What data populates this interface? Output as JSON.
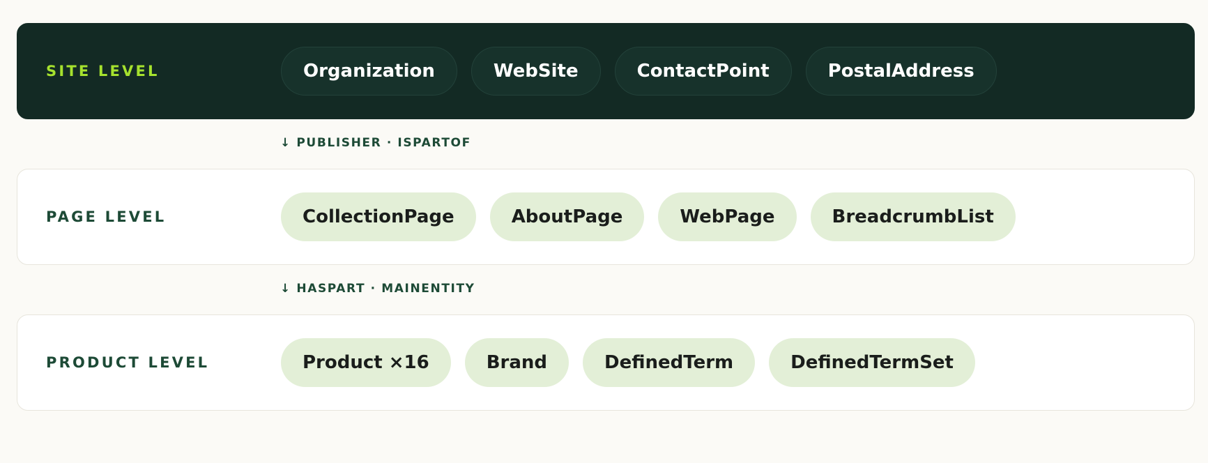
{
  "levels": [
    {
      "label": "SITE LEVEL",
      "theme": "dark",
      "chips": [
        "Organization",
        "WebSite",
        "ContactPoint",
        "PostalAddress"
      ]
    },
    {
      "label": "PAGE LEVEL",
      "theme": "light",
      "chips": [
        "CollectionPage",
        "AboutPage",
        "WebPage",
        "BreadcrumbList"
      ]
    },
    {
      "label": "PRODUCT LEVEL",
      "theme": "light",
      "chips": [
        "Product ×16",
        "Brand",
        "DefinedTerm",
        "DefinedTermSet"
      ]
    }
  ],
  "connectors": [
    "↓ PUBLISHER · ISPARTOF",
    "↓ HASPART · MAINENTITY"
  ],
  "colors": {
    "background": "#fbfaf6",
    "site_row": "#132a24",
    "site_label": "#a6e22e",
    "light_label": "#1d4a36",
    "light_chip": "#e3efd7"
  }
}
